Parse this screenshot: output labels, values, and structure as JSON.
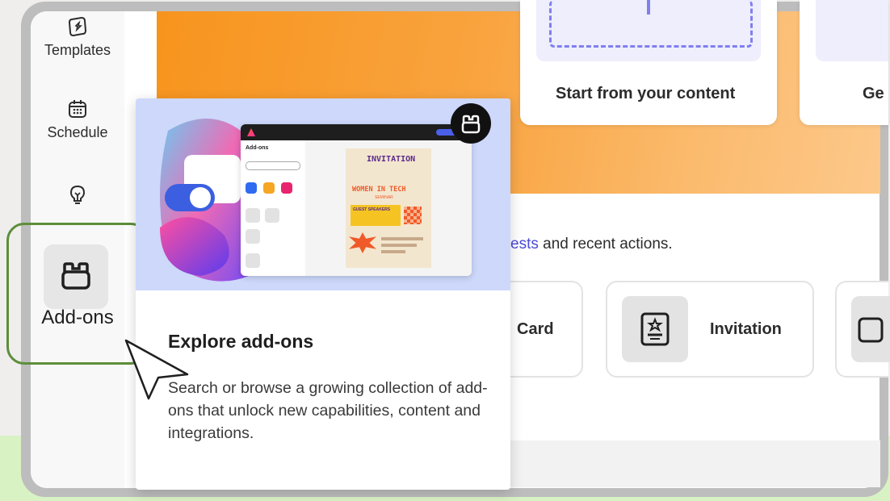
{
  "sidebar": {
    "items": [
      {
        "label": "Templates",
        "icon": "templates-icon"
      },
      {
        "label": "Schedule",
        "icon": "calendar-icon"
      },
      {
        "label": "",
        "icon": "lightbulb-icon"
      },
      {
        "label": "Add-ons",
        "icon": "addons-icon"
      }
    ]
  },
  "cards": {
    "start_content": "Start from your content",
    "partial_card": "Ge"
  },
  "recent": {
    "link_text": "ests",
    "rest_text": " and recent actions."
  },
  "quick_actions": [
    {
      "label": "Card"
    },
    {
      "label": "Invitation",
      "icon": "invitation-icon"
    }
  ],
  "popup": {
    "title": "Explore add-ons",
    "body": "Search or browse a growing collection of add-ons that unlock new capabilities, content and integrations.",
    "mini": {
      "panel_title": "Add-ons",
      "poster": {
        "heading": "INVITATION",
        "subheading": "WOMEN IN TECH",
        "seminar": "SEMINAR",
        "speakers": "GUEST SPEAKERS"
      }
    }
  },
  "colors": {
    "accent_green": "#5d8e3a",
    "banner_orange": "#f7941d",
    "link_blue": "#4b4bd8",
    "hero_blue": "#cdd8fb"
  }
}
